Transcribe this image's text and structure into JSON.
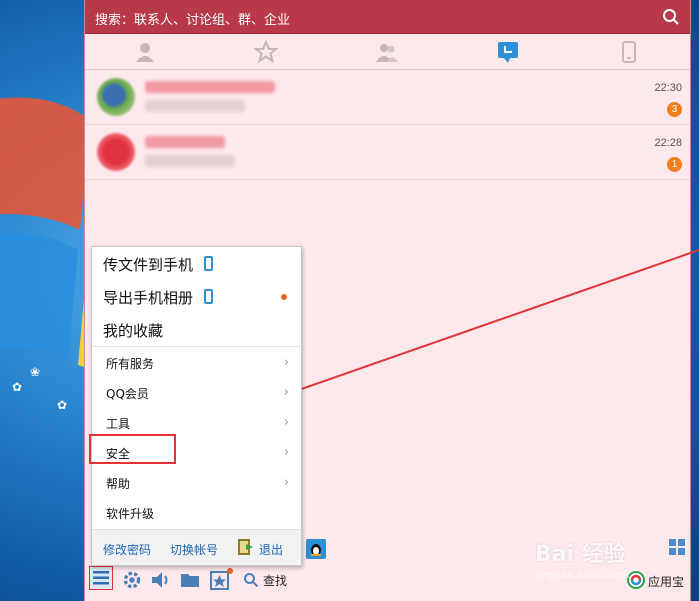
{
  "search": {
    "placeholder": "搜索：联系人、讨论组、群、企业"
  },
  "tabs": [
    {
      "icon": "contact-icon"
    },
    {
      "icon": "star-icon"
    },
    {
      "icon": "group-icon"
    },
    {
      "icon": "recent-chat-icon",
      "active": true
    },
    {
      "icon": "phone-icon"
    }
  ],
  "contacts": [
    {
      "time": "22:30",
      "unread": "3"
    },
    {
      "time": "22:28",
      "unread": "1"
    }
  ],
  "menu": {
    "top_items": [
      {
        "label": "传文件到手机",
        "icon": "phone-icon"
      },
      {
        "label": "导出手机相册",
        "icon": "phone-icon",
        "new_dot": true
      },
      {
        "label": "我的收藏"
      }
    ],
    "items": [
      {
        "label": "所有服务",
        "submenu": true
      },
      {
        "label": "QQ会员",
        "submenu": true
      },
      {
        "label": "工具",
        "submenu": true
      },
      {
        "label": "安全",
        "submenu": true,
        "highlighted": true
      },
      {
        "label": "帮助",
        "submenu": true
      },
      {
        "label": "软件升级",
        "submenu": false
      }
    ],
    "footer": {
      "change_password": "修改密码",
      "switch_account": "切换帐号",
      "logout": "退出"
    }
  },
  "bottom_bar": {
    "find_label": "查找",
    "app_store_label": "应用宝"
  },
  "watermark": {
    "main": "Bai 经验",
    "sub": "jingyan.baidu.com"
  },
  "colors": {
    "title_bar": "#b83a48",
    "panel_bg": "#fde8ec",
    "accent_blue": "#2d8fd6",
    "badge_orange": "#f0801e",
    "annotation_red": "#e2333a"
  }
}
